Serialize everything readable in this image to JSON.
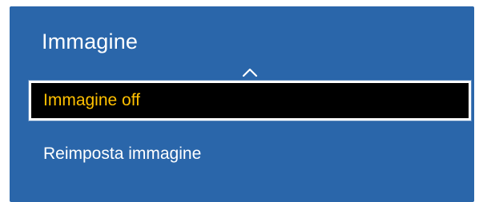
{
  "menu": {
    "title": "Immagine",
    "scroll_indicator": "chevron-up-icon",
    "items": [
      {
        "label": "Immagine off",
        "selected": true
      },
      {
        "label": "Reimposta immagine",
        "selected": false
      }
    ]
  },
  "colors": {
    "panel_background": "#2a66aa",
    "selected_background": "#000000",
    "selected_text": "#ffc000",
    "text": "#ffffff"
  }
}
